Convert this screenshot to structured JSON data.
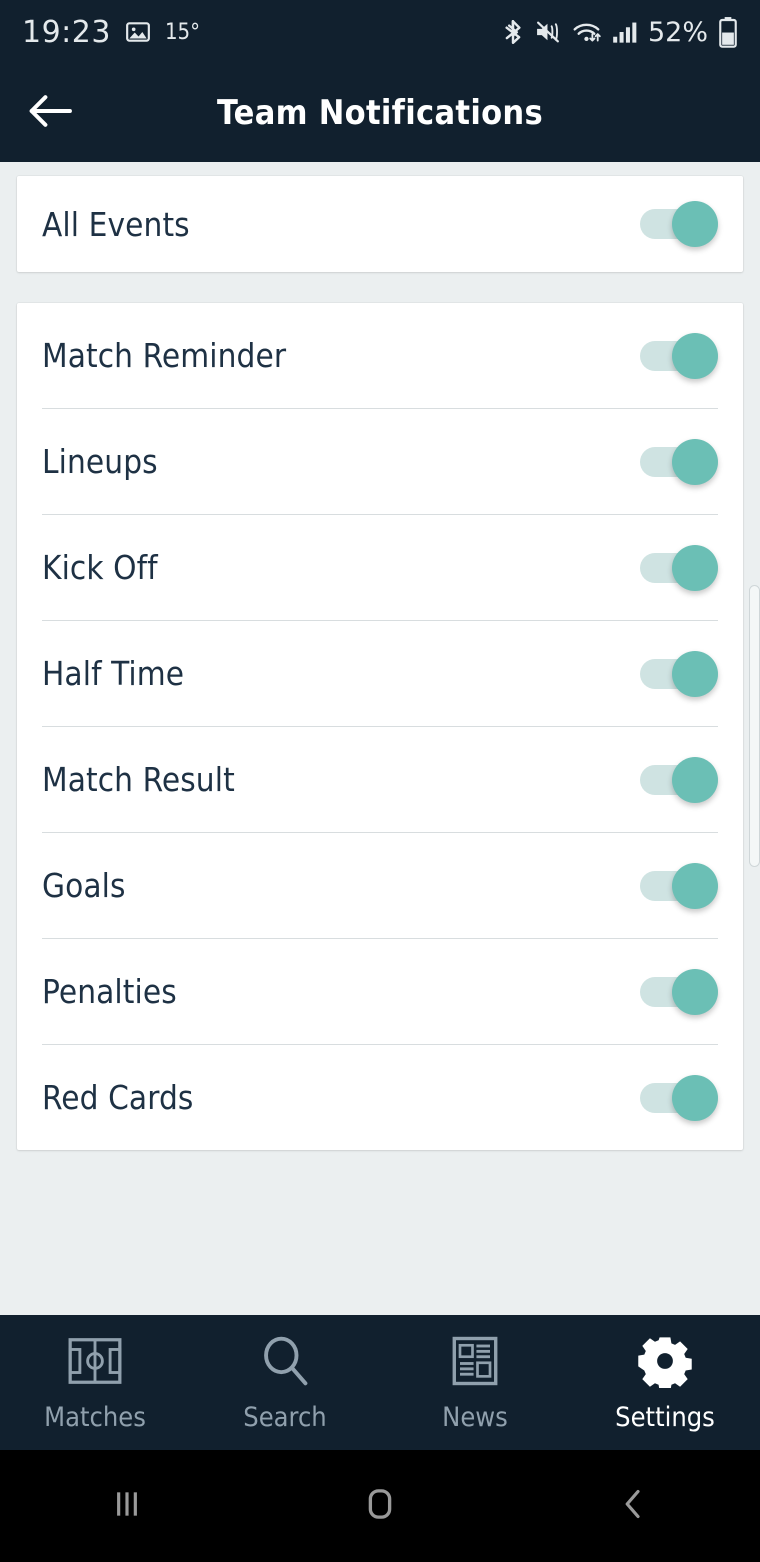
{
  "status_bar": {
    "time": "19:23",
    "photo_icon": "image-icon",
    "temperature": "15°",
    "bluetooth_icon": "bluetooth-icon",
    "sound_icon": "mute-vibrate-icon",
    "wifi_icon": "wifi-icon",
    "signal_icon": "cellular-signal-icon",
    "battery_percent": "52%",
    "battery_icon": "battery-icon"
  },
  "app_bar": {
    "back_icon": "back-arrow-icon",
    "title": "Team Notifications"
  },
  "all_events": {
    "label": "All Events",
    "enabled": true
  },
  "notification_list": [
    {
      "label": "Match Reminder",
      "enabled": true
    },
    {
      "label": "Lineups",
      "enabled": true
    },
    {
      "label": "Kick Off",
      "enabled": true
    },
    {
      "label": "Half Time",
      "enabled": true
    },
    {
      "label": "Match Result",
      "enabled": true
    },
    {
      "label": "Goals",
      "enabled": true
    },
    {
      "label": "Penalties",
      "enabled": true
    },
    {
      "label": "Red Cards",
      "enabled": true
    }
  ],
  "bottom_nav": [
    {
      "label": "Matches",
      "icon": "pitch-icon",
      "active": false
    },
    {
      "label": "Search",
      "icon": "search-icon",
      "active": false
    },
    {
      "label": "News",
      "icon": "newspaper-icon",
      "active": false
    },
    {
      "label": "Settings",
      "icon": "gear-icon",
      "active": true
    }
  ],
  "system_nav": {
    "recents_icon": "recents-icon",
    "home_icon": "home-icon",
    "back_icon": "back-chevron-icon"
  },
  "colors": {
    "header_bg": "#11202e",
    "page_bg": "#ebeff0",
    "card_bg": "#ffffff",
    "accent_teal": "#6bbfb5",
    "track_teal": "#cfe3e2",
    "text_dark": "#1e3144",
    "nav_inactive": "#90a0ad"
  }
}
